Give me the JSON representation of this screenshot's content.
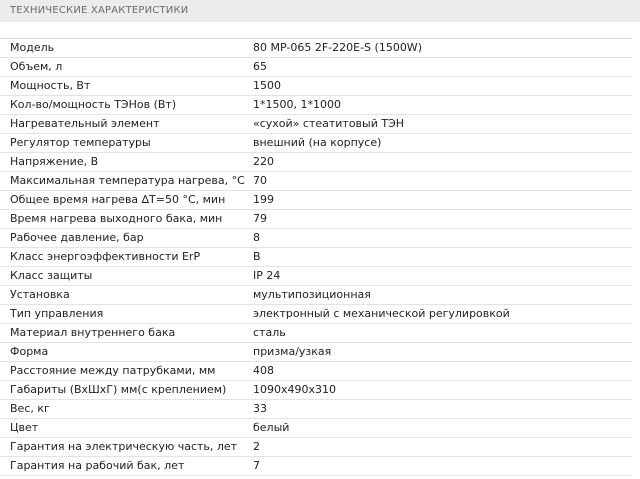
{
  "header": {
    "title": "ТЕХНИЧЕСКИЕ ХАРАКТЕРИСТИКИ"
  },
  "specs": [
    {
      "name": "Модель",
      "value": "80 MP-065 2F-220E-S (1500W)"
    },
    {
      "name": "Объем, л",
      "value": "65"
    },
    {
      "name": "Мощность, Вт",
      "value": "1500"
    },
    {
      "name": "Кол-во/мощность ТЭНов (Вт)",
      "value": "1*1500, 1*1000"
    },
    {
      "name": "Нагревательный элемент",
      "value": "«сухой» стеатитовый ТЭН"
    },
    {
      "name": "Регулятор температуры",
      "value": "внешний (на корпусе)"
    },
    {
      "name": "Напряжение, В",
      "value": "220"
    },
    {
      "name": "Максимальная температура нагрева, °С",
      "value": "70"
    },
    {
      "name": "Общее время нагрева ∆T=50 °С, мин",
      "value": "199"
    },
    {
      "name": "Время нагрева выходного бака, мин",
      "value": "79"
    },
    {
      "name": "Рабочее давление, бар",
      "value": "8"
    },
    {
      "name": "Класс энергоэффективности ErP",
      "value": "B"
    },
    {
      "name": "Класс защиты",
      "value": "IP 24"
    },
    {
      "name": "Установка",
      "value": "мультипозиционная"
    },
    {
      "name": "Тип управления",
      "value": "электронный с механической регулировкой"
    },
    {
      "name": "Материал внутреннего бака",
      "value": "сталь"
    },
    {
      "name": "Форма",
      "value": "призма/узкая"
    },
    {
      "name": "Расстояние между патрубками, мм",
      "value": "408"
    },
    {
      "name": "Габариты (ВхШхГ) мм(с креплением)",
      "value": "1090x490x310"
    },
    {
      "name": "Вес, кг",
      "value": "33"
    },
    {
      "name": "Цвет",
      "value": "белый"
    },
    {
      "name": "Гарантия на электрическую часть, лет",
      "value": "2"
    },
    {
      "name": "Гарантия на рабочий бак, лет",
      "value": "7"
    }
  ]
}
